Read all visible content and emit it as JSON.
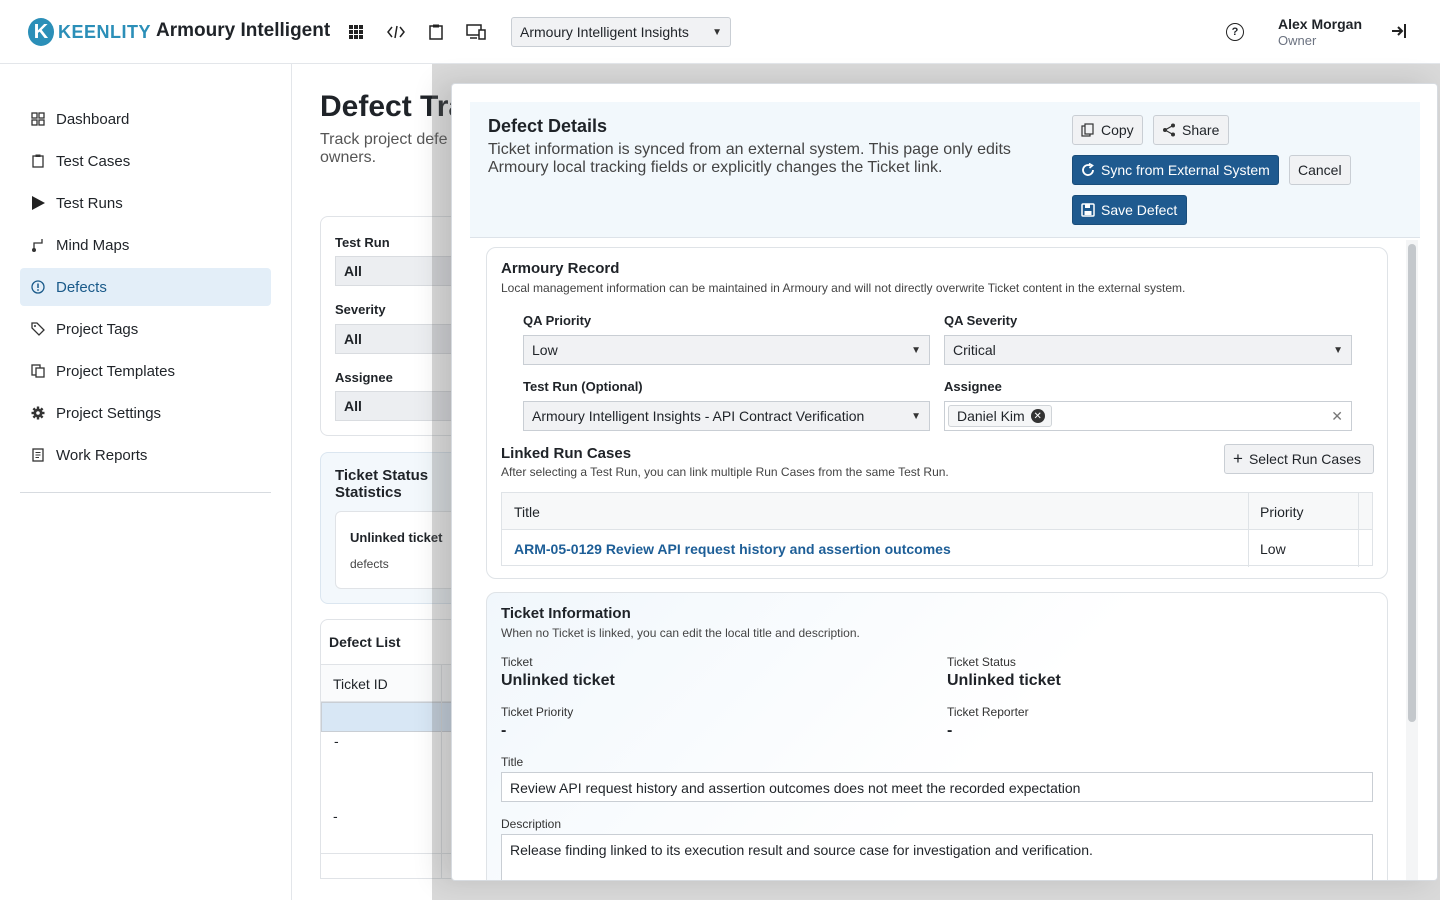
{
  "app": {
    "logo_letter": "K",
    "logo_text": "KEENLITY",
    "title": "Armoury Intelligent"
  },
  "topbar": {
    "icons": [
      "grid-icon",
      "code-icon",
      "clipboard-icon",
      "devices-icon"
    ],
    "project_select": "Armoury Intelligent Insights",
    "help_symbol": "?",
    "user_name": "Alex Morgan",
    "user_role": "Owner"
  },
  "sidebar": {
    "items": [
      {
        "label": "Dashboard",
        "icon": "dashboard-icon"
      },
      {
        "label": "Test Cases",
        "icon": "clipboard-icon"
      },
      {
        "label": "Test Runs",
        "icon": "play-icon"
      },
      {
        "label": "Mind Maps",
        "icon": "mind-map-icon"
      },
      {
        "label": "Defects",
        "icon": "alert-circle-icon",
        "active": true
      },
      {
        "label": "Project Tags",
        "icon": "tag-icon"
      },
      {
        "label": "Project Templates",
        "icon": "templates-icon"
      },
      {
        "label": "Project Settings",
        "icon": "gear-icon"
      },
      {
        "label": "Work Reports",
        "icon": "report-icon"
      }
    ]
  },
  "page": {
    "title": "Defect Tra",
    "subtitle": "Track project defe owners.",
    "filters": {
      "test_run_label": "Test Run",
      "test_run_value": "All",
      "severity_label": "Severity",
      "severity_value": "All",
      "assignee_label": "Assignee",
      "assignee_value": "All"
    },
    "stats": {
      "title": "Ticket Status Statistics",
      "card_title": "Unlinked ticket",
      "card_sub": "defects"
    },
    "list": {
      "title": "Defect List",
      "col_ticket_id": "Ticket ID",
      "rows": [
        "-",
        "-"
      ]
    }
  },
  "dialog": {
    "title": "Defect Details",
    "description": "Ticket information is synced from an external system. This page only edits Armoury local tracking fields or explicitly changes the Ticket link.",
    "buttons": {
      "copy": "Copy",
      "share": "Share",
      "sync": "Sync from External System",
      "cancel": "Cancel",
      "save": "Save Defect"
    },
    "armoury_record": {
      "title": "Armoury Record",
      "description": "Local management information can be maintained in Armoury and will not directly overwrite Ticket content in the external system.",
      "qa_priority_label": "QA Priority",
      "qa_priority_value": "Low",
      "qa_severity_label": "QA Severity",
      "qa_severity_value": "Critical",
      "test_run_label": "Test Run (Optional)",
      "test_run_value": "Armoury Intelligent Insights - API Contract Verification",
      "assignee_label": "Assignee",
      "assignee_chip": "Daniel Kim",
      "linked_title": "Linked Run Cases",
      "linked_desc": "After selecting a Test Run, you can link multiple Run Cases from the same Test Run.",
      "select_button": "Select Run Cases",
      "table": {
        "col_title": "Title",
        "col_priority": "Priority",
        "rows": [
          {
            "title": "ARM-05-0129 Review API request history and assertion outcomes",
            "priority": "Low"
          }
        ]
      }
    },
    "ticket_info": {
      "title": "Ticket Information",
      "description": "When no Ticket is linked, you can edit the local title and description.",
      "ticket_label": "Ticket",
      "ticket_value": "Unlinked ticket",
      "status_label": "Ticket Status",
      "status_value": "Unlinked ticket",
      "priority_label": "Ticket Priority",
      "priority_value": "-",
      "reporter_label": "Ticket Reporter",
      "reporter_value": "-",
      "title_label": "Title",
      "title_value": "Review API request history and assertion outcomes does not meet the recorded expectation",
      "desc_label": "Description",
      "desc_value": "Release finding linked to its execution result and source case for investigation and verification."
    }
  }
}
